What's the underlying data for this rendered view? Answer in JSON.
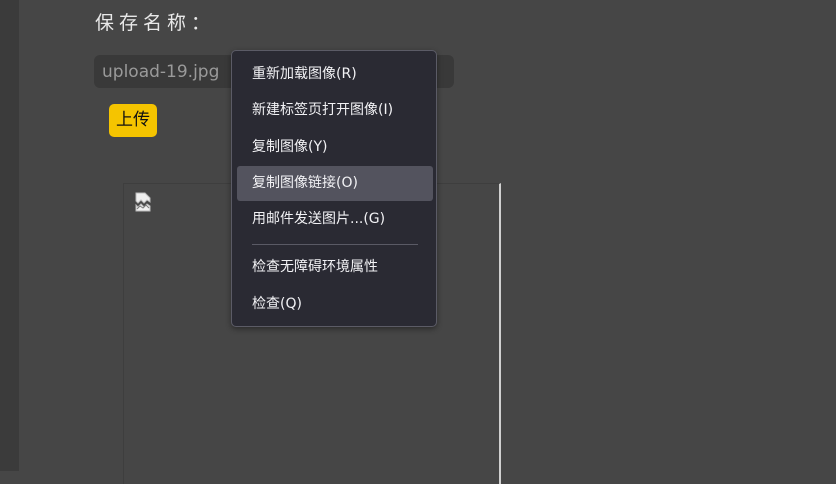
{
  "form": {
    "save_label": "保存名称：",
    "filename_value": "upload-19.jpg",
    "upload_label": "上传"
  },
  "image": {
    "broken_icon": "broken-image-icon"
  },
  "context_menu": {
    "items": [
      {
        "label": "重新加载图像(R)"
      },
      {
        "label": "新建标签页打开图像(I)"
      },
      {
        "label": "复制图像(Y)"
      },
      {
        "label": "复制图像链接(O)",
        "highlighted": true
      },
      {
        "label": "用邮件发送图片...(G)"
      },
      {
        "label": "检查无障碍环境属性"
      },
      {
        "label": "检查(Q)"
      }
    ]
  },
  "colors": {
    "accent": "#f5c400",
    "background": "#464646",
    "menu_background": "#2a2a33",
    "menu_highlight": "#53535e"
  }
}
